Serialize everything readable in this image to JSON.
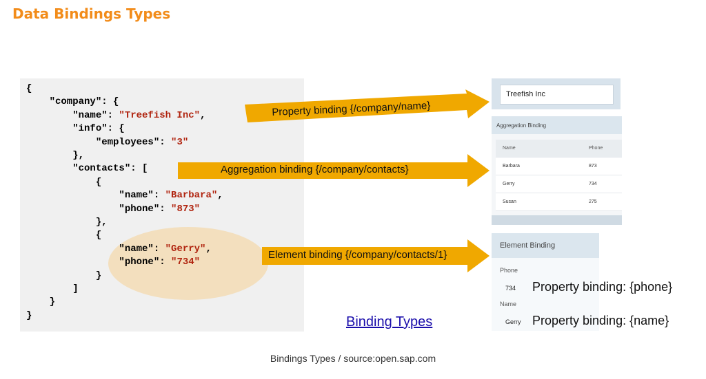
{
  "title": "Data Bindings Types",
  "code_lines": [
    {
      "parts": [
        {
          "t": "{",
          "s": false
        }
      ]
    },
    {
      "parts": [
        {
          "t": "    \"company\": {",
          "s": false
        }
      ]
    },
    {
      "parts": [
        {
          "t": "        \"name\": ",
          "s": false
        },
        {
          "t": "\"Treefish Inc\"",
          "s": true
        },
        {
          "t": ",",
          "s": false
        }
      ]
    },
    {
      "parts": [
        {
          "t": "        \"info\": {",
          "s": false
        }
      ]
    },
    {
      "parts": [
        {
          "t": "            \"employees\": ",
          "s": false
        },
        {
          "t": "\"3\"",
          "s": true
        }
      ]
    },
    {
      "parts": [
        {
          "t": "        },",
          "s": false
        }
      ]
    },
    {
      "parts": [
        {
          "t": "        \"contacts\": [",
          "s": false
        }
      ]
    },
    {
      "parts": [
        {
          "t": "            {",
          "s": false
        }
      ]
    },
    {
      "parts": [
        {
          "t": "                \"name\": ",
          "s": false
        },
        {
          "t": "\"Barbara\"",
          "s": true
        },
        {
          "t": ",",
          "s": false
        }
      ]
    },
    {
      "parts": [
        {
          "t": "                \"phone\": ",
          "s": false
        },
        {
          "t": "\"873\"",
          "s": true
        }
      ]
    },
    {
      "parts": [
        {
          "t": "            },",
          "s": false
        }
      ]
    },
    {
      "parts": [
        {
          "t": "            {",
          "s": false
        }
      ]
    },
    {
      "parts": [
        {
          "t": "                \"name\": ",
          "s": false
        },
        {
          "t": "\"Gerry\"",
          "s": true
        },
        {
          "t": ",",
          "s": false
        }
      ]
    },
    {
      "parts": [
        {
          "t": "                \"phone\": ",
          "s": false
        },
        {
          "t": "\"734\"",
          "s": true
        }
      ]
    },
    {
      "parts": [
        {
          "t": "            }",
          "s": false
        }
      ]
    },
    {
      "parts": [
        {
          "t": "        ]",
          "s": false
        }
      ]
    },
    {
      "parts": [
        {
          "t": "    }",
          "s": false
        }
      ]
    },
    {
      "parts": [
        {
          "t": "}",
          "s": false
        }
      ]
    }
  ],
  "arrows": {
    "property": "Property binding {/company/name}",
    "aggregation": "Aggregation binding {/company/contacts}",
    "element": "Element binding {/company/contacts/1}"
  },
  "property_panel": {
    "value": "Treefish Inc"
  },
  "aggregation_panel": {
    "title": "Aggregation Binding",
    "columns": [
      "Name",
      "Phone"
    ],
    "rows": [
      {
        "name": "Barbara",
        "phone": "873"
      },
      {
        "name": "Gerry",
        "phone": "734"
      },
      {
        "name": "Susan",
        "phone": "275"
      }
    ]
  },
  "element_panel": {
    "title": "Element Binding",
    "phone_label": "Phone",
    "phone_value": "734",
    "name_label": "Name",
    "name_value": "Gerry"
  },
  "property_labels": {
    "phone": "Property binding: {phone}",
    "name": "Property binding: {name}"
  },
  "link_text": "Binding Types",
  "caption": "Bindings Types / source:open.sap.com",
  "colors": {
    "accent": "#f28c1a",
    "arrow": "#f0a800",
    "string": "#b0230e",
    "highlight": "#f3dfbe"
  }
}
